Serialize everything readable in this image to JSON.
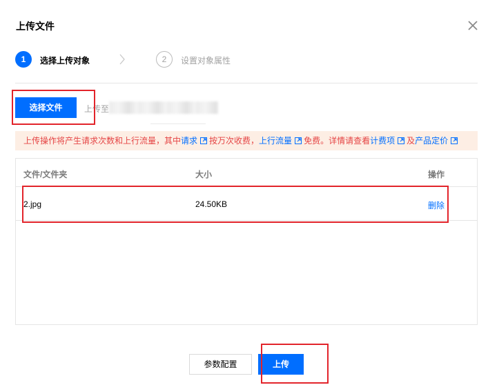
{
  "dialog": {
    "title": "上传文件",
    "close_icon": "close-icon"
  },
  "steps": [
    {
      "number": "1",
      "label": "选择上传对象",
      "state": "active"
    },
    {
      "number": "2",
      "label": "设置对象属性",
      "state": "inactive"
    }
  ],
  "file_select": {
    "button_label": "选择文件",
    "upload_to_label": "上传至"
  },
  "notice": {
    "part1": "上传操作将产生请求次数和上行流量，其中",
    "link_requests": "请求",
    "part2": "按万次收费，",
    "link_traffic": "上行流量",
    "part3": "免费。详情请查看",
    "link_billing": "计费项",
    "part4": "及",
    "link_pricing": "产品定价"
  },
  "table": {
    "columns": [
      "文件/文件夹",
      "大小",
      "操作"
    ],
    "rows": [
      {
        "name": "2.jpg",
        "size": "24.50KB",
        "action": "删除"
      }
    ]
  },
  "footer": {
    "config_label": "参数配置",
    "upload_label": "上传"
  },
  "colors": {
    "primary": "#006eff",
    "notice_bg": "#fdeee4",
    "notice_text": "#e54545",
    "highlight": "#e2232a"
  }
}
